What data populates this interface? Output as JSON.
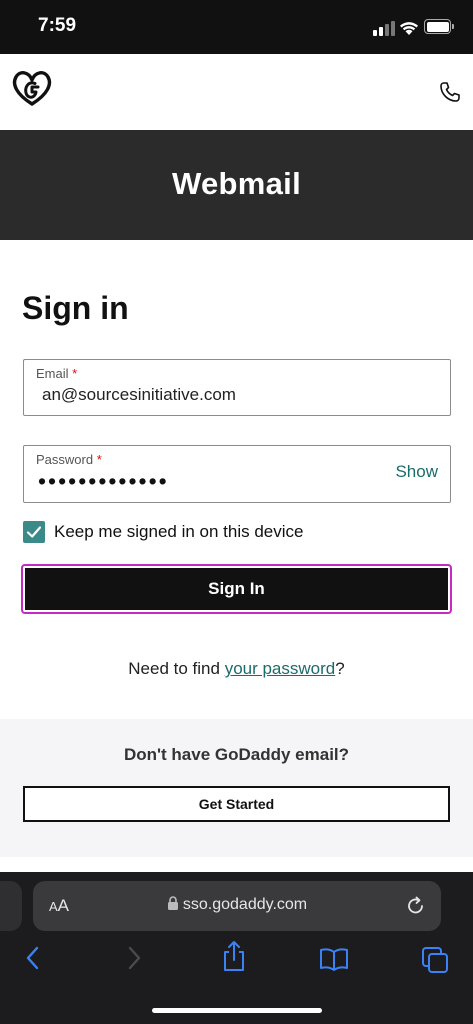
{
  "status_bar": {
    "time": "7:59"
  },
  "header": {
    "title": "Webmail"
  },
  "form": {
    "heading": "Sign in",
    "email_label": "Email",
    "email_value": "an@sourcesinitiative.com",
    "password_label": "Password",
    "password_value": "•••••••••••••",
    "show_label": "Show",
    "required_mark": "*",
    "keep_signed_in_label": "Keep me signed in on this device",
    "keep_signed_in_checked": true,
    "submit_label": "Sign In",
    "help_text_prefix": "Need to find ",
    "help_link": "your password",
    "help_text_suffix": "?"
  },
  "promo": {
    "question": "Don't have GoDaddy email?",
    "button_label": "Get Started"
  },
  "browser": {
    "text_size_label_small": "A",
    "text_size_label_large": "A",
    "url": "sso.godaddy.com"
  },
  "colors": {
    "accent_teal": "#3a8a8a",
    "link_teal": "#1c6b6b",
    "focus_outline": "#c32bc3",
    "ios_blue": "#3b82f6"
  }
}
